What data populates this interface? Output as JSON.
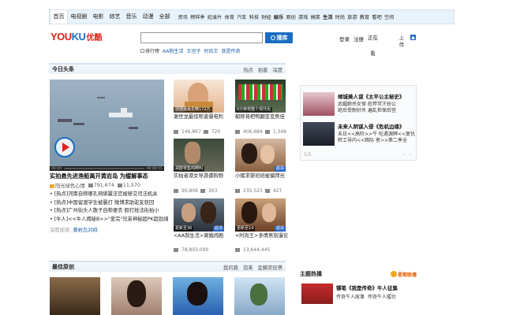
{
  "nav": {
    "primary": [
      "首页",
      "电视剧",
      "电影",
      "综艺",
      "音乐",
      "动漫",
      "全部"
    ],
    "secondary": [
      "资讯",
      "榜样季",
      "纪录片",
      "体育",
      "汽车",
      "科技",
      "财经",
      "娱乐",
      "原创",
      "游戏",
      "搞笑",
      "生活",
      "时尚",
      "旅游",
      "教育",
      "看吧",
      "空间"
    ],
    "secondary_bold": [
      "娱乐",
      "生活"
    ]
  },
  "logo": {
    "text_a": "YOU",
    "text_b": "KU",
    "text_cn": "优酷"
  },
  "search": {
    "button_label": "搜库",
    "value": ""
  },
  "hot_words": {
    "label": "排行榜",
    "items": [
      "AA制生活",
      "王坦子",
      "时尚王",
      "我是传奇"
    ]
  },
  "user": {
    "login": "登录",
    "register": "注册",
    "watching_a": "正在",
    "watching_b": "看",
    "upload_a": "上",
    "upload_b": "传"
  },
  "colors": {
    "brand_red": "#e2231a",
    "brand_blue": "#1a6dc2",
    "nav_bg": "#e8f2fa"
  },
  "headlines": {
    "title": "今日头条",
    "tabs": [
      "热点",
      "拍客",
      "深度"
    ],
    "main": {
      "title": "实拍悬先进渔船离开黄岩岛 为缓解事态",
      "uploader": "阳光绿色心情",
      "plays": "791,674",
      "comments": "11,570",
      "time_left": "00:00",
      "time_right": "00:00:55"
    },
    "bullets": [
      "[热点]河南自称哪孔祠堪翼法官被移交司法机关",
      "[热点]中国留渡学生被暴打 微博求助驼友获回",
      "[热点]广州街头人散子自称便衣 假打抢法街拍小",
      "[牛人]<<牛人揭秘B>>\"爱完\"兄弟神秘超PK超劲阔"
    ],
    "deep_read": {
      "label": "深度阅读:",
      "link": "黄岩岛对峙"
    }
  },
  "thumbs": [
    {
      "badge": "便捷最最爱精172万",
      "title": "谢世龙最惊称道僵电判",
      "plays": "146,867",
      "comments": "720"
    },
    {
      "badge": "6分钟将整个现代化",
      "title": "朝称将把鸭翻亚变焦佳",
      "plays": "406,684",
      "comments": "1,348"
    },
    {
      "badge": "郑醇零售鸣啊叫",
      "title": "实拍者港女导游遭购物",
      "plays": "90,806",
      "comments": "363"
    },
    {
      "badge": "",
      "tag": "超清",
      "title": "小猪求婴班班被偏拜光",
      "plays": "235,525",
      "comments": "427"
    },
    {
      "badge": "更新至36",
      "tag": "超清",
      "title": "<AA制生活>离婚闹剧",
      "plays": "78,803,090",
      "comments": ""
    },
    {
      "badge": "更新至14",
      "tag": "超清",
      "title": "<时尚王>多情男刻漫论",
      "plays": "13,644,445",
      "comments": ""
    }
  ],
  "ads": [
    {
      "title": "倾城美人谋《太平公主秘史》",
      "line1": "武媚娘杀女保",
      "line1b": "彪悍可汗扮公",
      "line2": "绝后受耐好杀",
      "line2b": "遍乱担保后宫"
    },
    {
      "title": "未来人阴谋入侵《危机边缘》",
      "line1": "末日<<高阶>>牛",
      "line1b": "吃遇源牌<<复仇",
      "line2": "转工导内<<暗际",
      "line2b": "者>>第二季全"
    }
  ],
  "ad_pager": "1/1",
  "original": {
    "title": "最佳原创",
    "tabs": [
      "我的路",
      "泡芙",
      "金麟奖投票"
    ]
  },
  "theme": {
    "title": "主题热播",
    "brand": "星期联播",
    "item_title": "镖笔《我是传奇》牛人征集",
    "line1": "传奇牛人故事",
    "line2": "传奇牛人擂台"
  }
}
